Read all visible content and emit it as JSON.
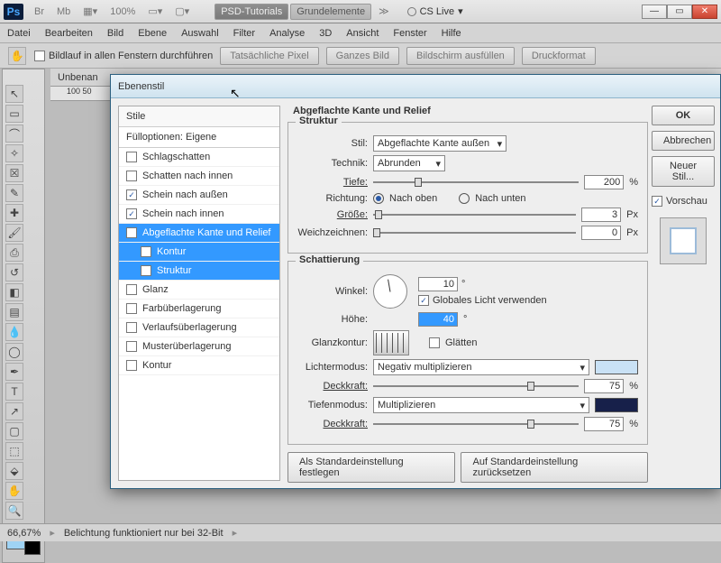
{
  "app": {
    "ps": "Ps",
    "br": "Br",
    "mb": "Mb",
    "zoom": "100%",
    "tab1": "PSD-Tutorials",
    "tab2": "Grundelemente",
    "cslive": "CS Live"
  },
  "menu": [
    "Datei",
    "Bearbeiten",
    "Bild",
    "Ebene",
    "Auswahl",
    "Filter",
    "Analyse",
    "3D",
    "Ansicht",
    "Fenster",
    "Hilfe"
  ],
  "opt": {
    "scroll": "Bildlauf in allen Fenstern durchführen",
    "b1": "Tatsächliche Pixel",
    "b2": "Ganzes Bild",
    "b3": "Bildschirm ausfüllen",
    "b4": "Druckformat"
  },
  "doc": {
    "tab": "Unbenan",
    "ruler": "100        50"
  },
  "dlg": {
    "title": "Ebenenstil",
    "styles_hdr": "Stile",
    "fill": "Fülloptionen: Eigene",
    "items": [
      {
        "label": "Schlagschatten",
        "on": false
      },
      {
        "label": "Schatten nach innen",
        "on": false
      },
      {
        "label": "Schein nach außen",
        "on": true
      },
      {
        "label": "Schein nach innen",
        "on": true
      },
      {
        "label": "Abgeflachte Kante und Relief",
        "on": true,
        "sel": true
      },
      {
        "label": "Kontur",
        "on": false,
        "sub": true,
        "sel": true
      },
      {
        "label": "Struktur",
        "on": false,
        "sub": true,
        "sel": true
      },
      {
        "label": "Glanz",
        "on": false
      },
      {
        "label": "Farbüberlagerung",
        "on": false
      },
      {
        "label": "Verlaufsüberlagerung",
        "on": false
      },
      {
        "label": "Musterüberlagerung",
        "on": false
      },
      {
        "label": "Kontur",
        "on": false
      }
    ],
    "panel_title": "Abgeflachte Kante und Relief",
    "struct": {
      "legend": "Struktur",
      "stil_l": "Stil:",
      "stil_v": "Abgeflachte Kante außen",
      "tech_l": "Technik:",
      "tech_v": "Abrunden",
      "tiefe_l": "Tiefe:",
      "tiefe_v": "200",
      "pct": "%",
      "richt_l": "Richtung:",
      "up": "Nach oben",
      "down": "Nach unten",
      "size_l": "Größe:",
      "size_v": "3",
      "px": "Px",
      "soft_l": "Weichzeichnen:",
      "soft_v": "0"
    },
    "shade": {
      "legend": "Schattierung",
      "winkel_l": "Winkel:",
      "winkel_v": "10",
      "deg": "°",
      "global": "Globales Licht verwenden",
      "hoehe_l": "Höhe:",
      "hoehe_v": "40",
      "gloss_l": "Glanzkontur:",
      "smooth": "Glätten",
      "light_l": "Lichtermodus:",
      "light_v": "Negativ multiplizieren",
      "opac_l": "Deckkraft:",
      "opac_v": "75",
      "shadow_l": "Tiefenmodus:",
      "shadow_v": "Multiplizieren",
      "opac2_v": "75"
    },
    "defaults": {
      "set": "Als Standardeinstellung festlegen",
      "reset": "Auf Standardeinstellung zurücksetzen"
    },
    "side": {
      "ok": "OK",
      "cancel": "Abbrechen",
      "new": "Neuer Stil...",
      "preview": "Vorschau"
    }
  },
  "status": {
    "zoom": "66,67%",
    "msg": "Belichtung funktioniert nur bei 32-Bit"
  }
}
